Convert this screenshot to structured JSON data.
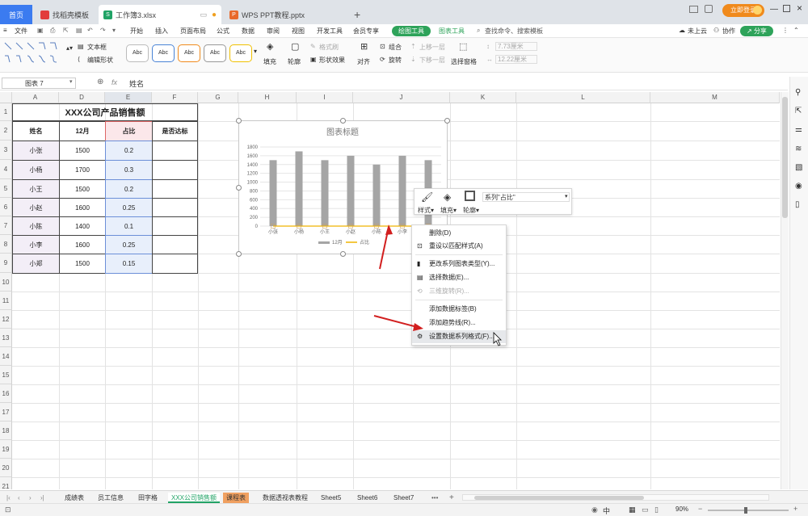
{
  "tabs": {
    "home": "首页",
    "t1": "找稻壳模板",
    "t2": "工作簿3.xlsx",
    "t3": "WPS PPT教程.pptx",
    "add": "+",
    "login": "立即登录"
  },
  "menu": {
    "file": "文件",
    "items": [
      "开始",
      "插入",
      "页面布局",
      "公式",
      "数据",
      "审阅",
      "视图",
      "开发工具",
      "会员专享"
    ],
    "draw_tools": "绘图工具",
    "chart_tools": "图表工具",
    "search": "查找命令、搜索模板",
    "cloud": "未上云",
    "collab": "协作",
    "share": "分享"
  },
  "ribbon": {
    "textbox": "文本框",
    "edit_shape": "编辑形状",
    "style_sample": "Abc",
    "fill": "填充",
    "outline": "轮廓",
    "format_brush": "格式刷",
    "shape_effect": "形状效果",
    "align": "对齐",
    "group": "组合",
    "rotate": "旋转",
    "up_layer": "上移一层",
    "down_layer": "下移一层",
    "selection_pane": "选择窗格",
    "height": "7.73厘米",
    "width": "12.22厘米"
  },
  "formula": {
    "namebox": "图表 7",
    "fx": "fx",
    "content": "姓名"
  },
  "columns": [
    "A",
    "D",
    "E",
    "F",
    "G",
    "H",
    "I",
    "J",
    "K",
    "L",
    "M"
  ],
  "rows": [
    "1",
    "2",
    "3",
    "4",
    "5",
    "6",
    "7",
    "8",
    "9",
    "10",
    "11",
    "12",
    "13",
    "14",
    "15",
    "16",
    "17",
    "18",
    "19",
    "20",
    "21"
  ],
  "table": {
    "title": "XXX公司产品销售额",
    "headers": [
      "姓名",
      "12月",
      "占比",
      "是否达标"
    ],
    "rows": [
      [
        "小张",
        "1500",
        "0.2",
        ""
      ],
      [
        "小杨",
        "1700",
        "0.3",
        ""
      ],
      [
        "小王",
        "1500",
        "0.2",
        ""
      ],
      [
        "小赵",
        "1600",
        "0.25",
        ""
      ],
      [
        "小陈",
        "1400",
        "0.1",
        ""
      ],
      [
        "小李",
        "1600",
        "0.25",
        ""
      ],
      [
        "小郑",
        "1500",
        "0.15",
        ""
      ]
    ]
  },
  "chart_data": {
    "type": "bar",
    "title": "图表标题",
    "categories": [
      "小张",
      "小杨",
      "小王",
      "小赵",
      "小陈",
      "小李",
      "小郑"
    ],
    "series": [
      {
        "name": "12月",
        "type": "bar",
        "values": [
          1500,
          1700,
          1500,
          1600,
          1400,
          1600,
          1500
        ],
        "color": "#a5a5a5"
      },
      {
        "name": "占比",
        "type": "line",
        "values": [
          0.2,
          0.3,
          0.2,
          0.25,
          0.1,
          0.25,
          0.15
        ],
        "color": "#f0b400"
      }
    ],
    "ylim": [
      0,
      1800
    ],
    "yticks": [
      "1800",
      "1600",
      "1400",
      "1200",
      "1000",
      "800",
      "600",
      "400",
      "200",
      "0"
    ],
    "grid": true,
    "legend": "bottom"
  },
  "floatbar": {
    "style": "样式",
    "fill": "填充",
    "outline": "轮廓",
    "series_select": "系列\"占比\""
  },
  "context_menu": {
    "items": [
      "删除(D)",
      "重设以匹配样式(A)",
      "更改系列图表类型(Y)...",
      "选择数据(E)...",
      "三维旋转(R)...",
      "添加数据标签(B)",
      "添加趋势线(R)...",
      "设置数据系列格式(F)..."
    ]
  },
  "sheet_tabs": [
    "成绩表",
    "员工信息",
    "田字格",
    "XXX公司销售额",
    "课程表",
    "数据透视表教程",
    "Sheet5",
    "Sheet6",
    "Sheet7"
  ],
  "status": {
    "ime": "中",
    "zoom": "90%"
  }
}
